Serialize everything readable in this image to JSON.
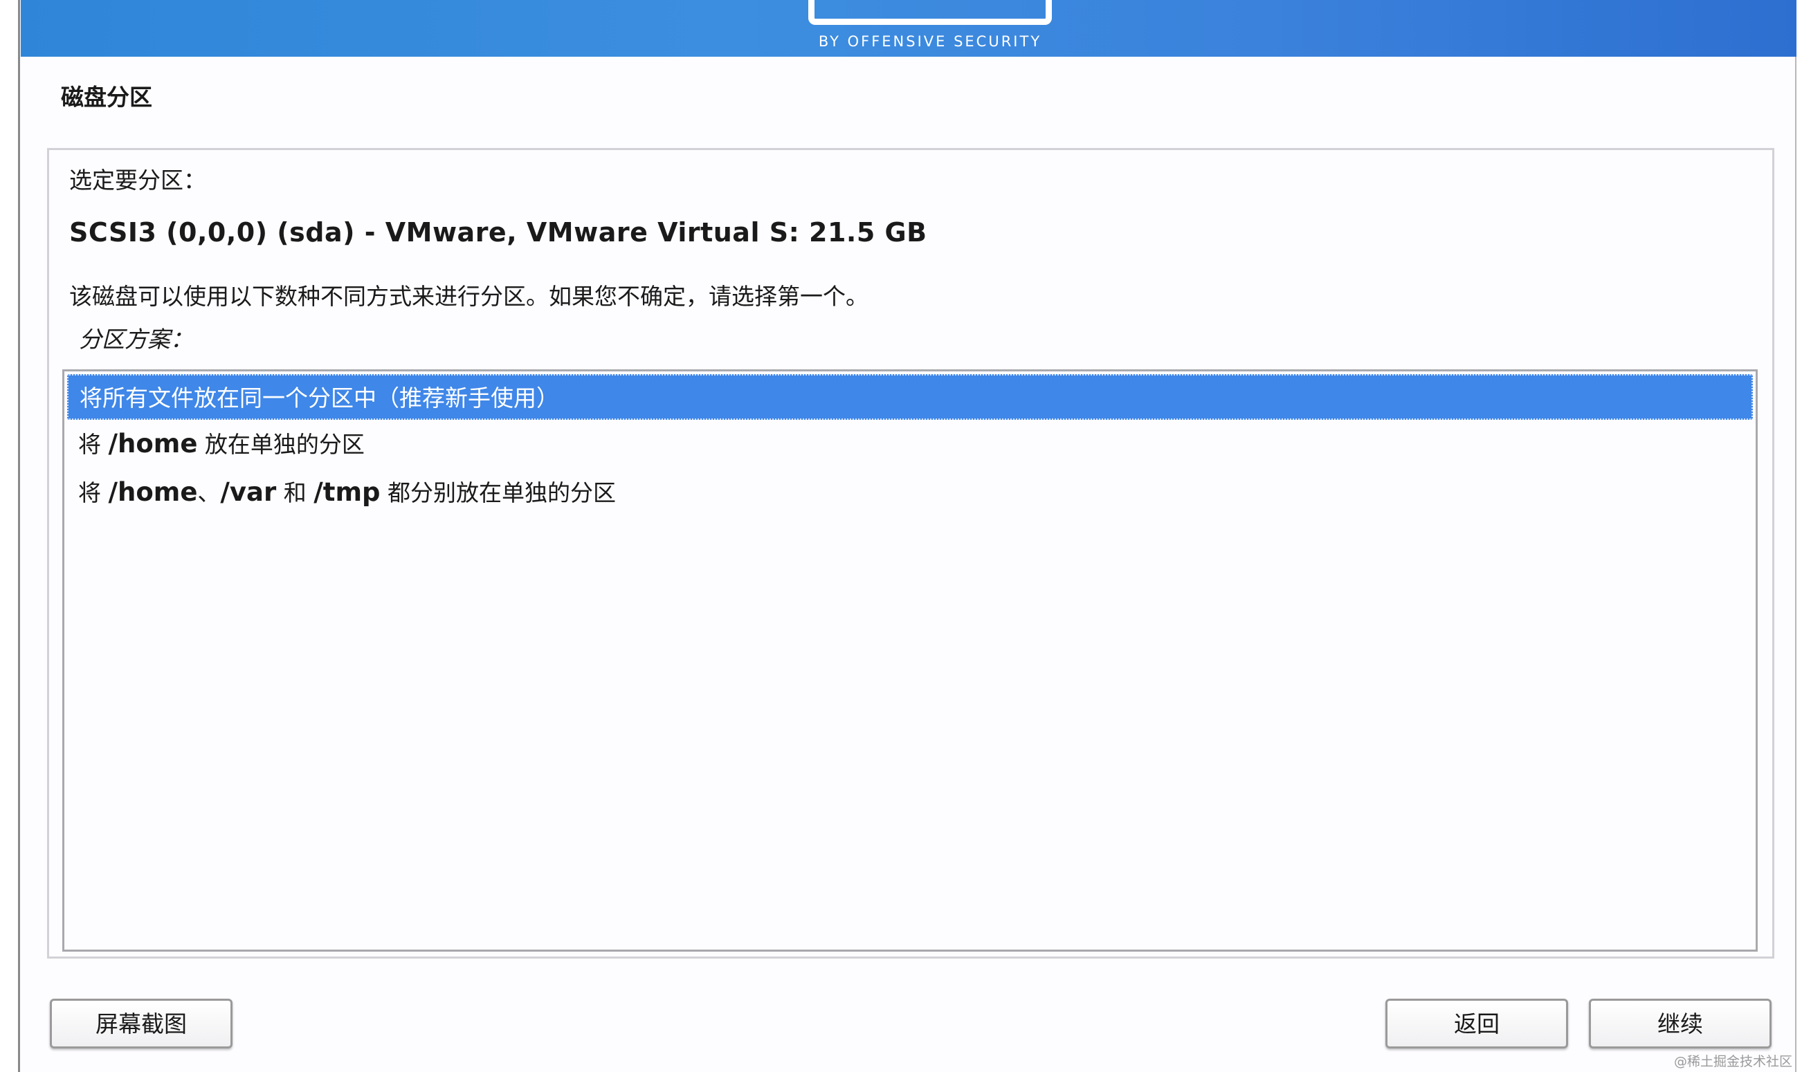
{
  "banner": {
    "logo_sub": "BY OFFENSIVE SECURITY"
  },
  "page": {
    "title": "磁盘分区"
  },
  "content": {
    "prompt": "选定要分区：",
    "disk_name": "SCSI3 (0,0,0) (sda) - VMware, VMware Virtual S: 21.5 GB",
    "description": "该磁盘可以使用以下数种不同方式来进行分区。如果您不确定，请选择第一个。",
    "scheme_label": "分区方案："
  },
  "options": [
    {
      "text": "将所有文件放在同一个分区中（推荐新手使用）",
      "selected": true
    },
    {
      "prefix": "将 ",
      "path1": "/home",
      "suffix": " 放在单独的分区",
      "selected": false
    },
    {
      "prefix": "将 ",
      "path1": "/home",
      "sep1": "、",
      "path2": "/var",
      "sep2": " 和 ",
      "path3": "/tmp",
      "suffix": " 都分别放在单独的分区",
      "selected": false
    }
  ],
  "buttons": {
    "screenshot": "屏幕截图",
    "back": "返回",
    "continue": "继续"
  },
  "watermark": "@稀土掘金技术社区",
  "colors": {
    "banner": "#3b87dc",
    "selection": "#3f87e8",
    "text": "#1a1a1a"
  }
}
